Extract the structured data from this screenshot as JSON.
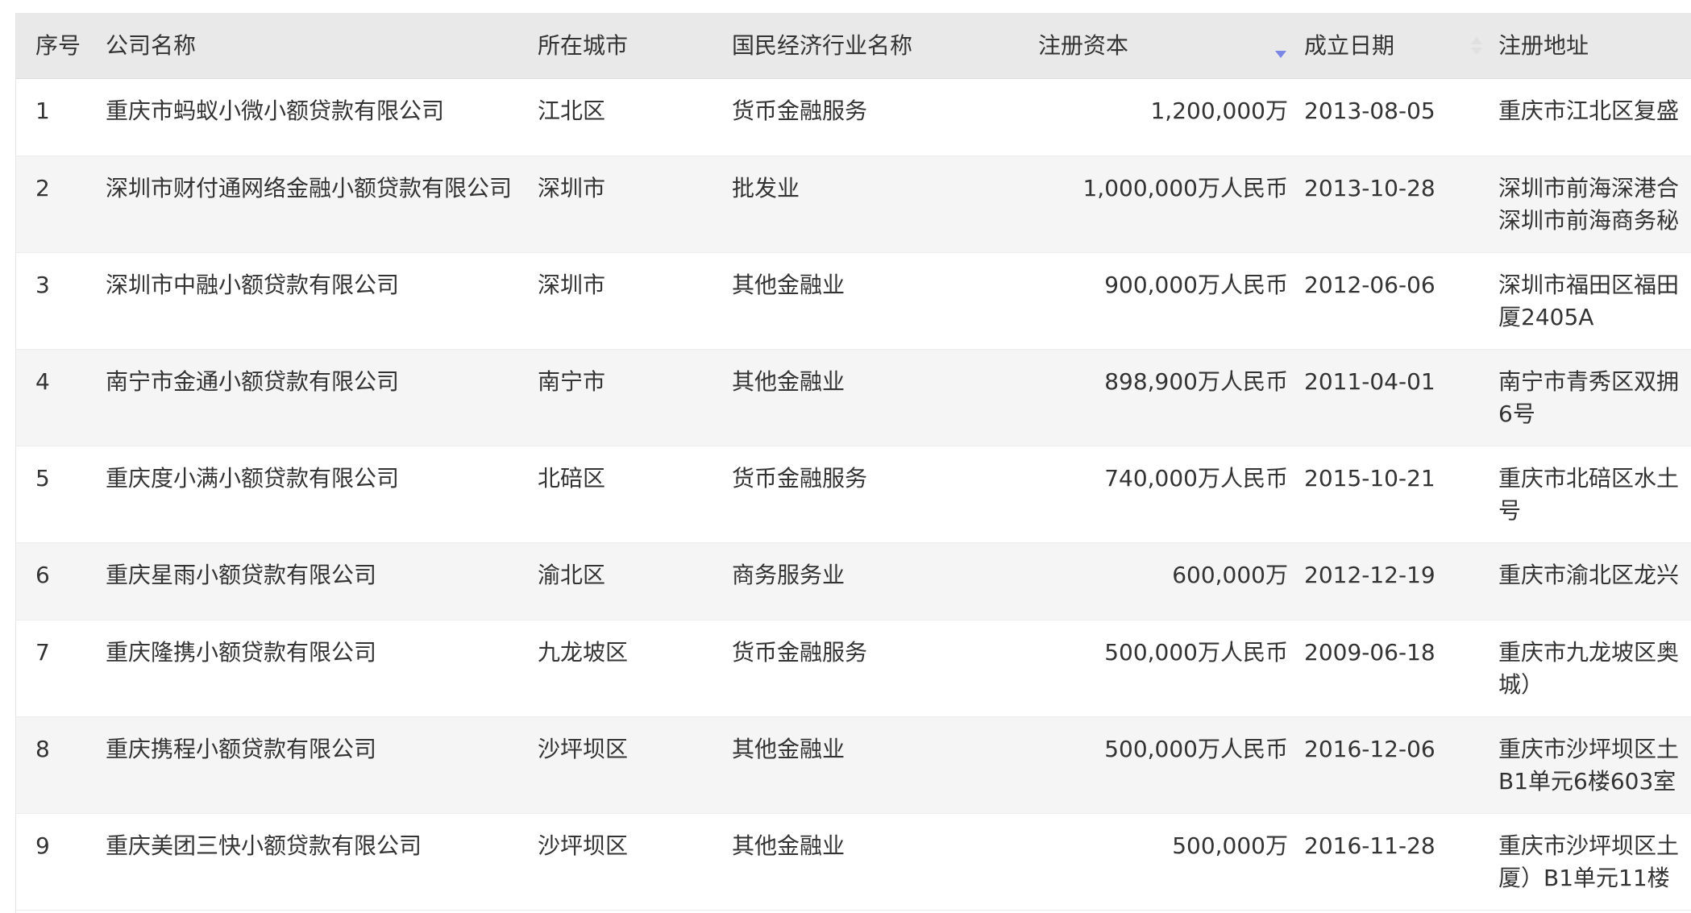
{
  "table": {
    "columns": {
      "index": "序号",
      "company": "公司名称",
      "city": "所在城市",
      "industry": "国民经济行业名称",
      "capital": "注册资本",
      "date": "成立日期",
      "address": "注册地址"
    },
    "sort": {
      "capital": "descending",
      "sort_active_color": "#7b87e6",
      "sort_inactive_color": "#e0e0e0"
    },
    "rows": [
      {
        "index": "1",
        "company": "重庆市蚂蚁小微小额贷款有限公司",
        "city": "江北区",
        "industry": "货币金融服务",
        "capital": "1,200,000万",
        "date": "2013-08-05",
        "address1": "重庆市江北区复盛",
        "address2": ""
      },
      {
        "index": "2",
        "company": "深圳市财付通网络金融小额贷款有限公司",
        "city": "深圳市",
        "industry": "批发业",
        "capital": "1,000,000万人民币",
        "date": "2013-10-28",
        "address1": "深圳市前海深港合",
        "address2": "深圳市前海商务秘"
      },
      {
        "index": "3",
        "company": "深圳市中融小额贷款有限公司",
        "city": "深圳市",
        "industry": "其他金融业",
        "capital": "900,000万人民币",
        "date": "2012-06-06",
        "address1": "深圳市福田区福田",
        "address2": "厦2405A"
      },
      {
        "index": "4",
        "company": "南宁市金通小额贷款有限公司",
        "city": "南宁市",
        "industry": "其他金融业",
        "capital": "898,900万人民币",
        "date": "2011-04-01",
        "address1": "南宁市青秀区双拥",
        "address2": "6号"
      },
      {
        "index": "5",
        "company": "重庆度小满小额贷款有限公司",
        "city": "北碚区",
        "industry": "货币金融服务",
        "capital": "740,000万人民币",
        "date": "2015-10-21",
        "address1": "重庆市北碚区水土",
        "address2": "号"
      },
      {
        "index": "6",
        "company": "重庆星雨小额贷款有限公司",
        "city": "渝北区",
        "industry": "商务服务业",
        "capital": "600,000万",
        "date": "2012-12-19",
        "address1": "重庆市渝北区龙兴",
        "address2": ""
      },
      {
        "index": "7",
        "company": "重庆隆携小额贷款有限公司",
        "city": "九龙坡区",
        "industry": "货币金融服务",
        "capital": "500,000万人民币",
        "date": "2009-06-18",
        "address1": "重庆市九龙坡区奥",
        "address2": "城）"
      },
      {
        "index": "8",
        "company": "重庆携程小额贷款有限公司",
        "city": "沙坪坝区",
        "industry": "其他金融业",
        "capital": "500,000万人民币",
        "date": "2016-12-06",
        "address1": "重庆市沙坪坝区土",
        "address2": "B1单元6楼603室"
      },
      {
        "index": "9",
        "company": "重庆美团三快小额贷款有限公司",
        "city": "沙坪坝区",
        "industry": "其他金融业",
        "capital": "500,000万",
        "date": "2016-11-28",
        "address1": "重庆市沙坪坝区土",
        "address2": "厦）B1单元11楼"
      }
    ]
  }
}
